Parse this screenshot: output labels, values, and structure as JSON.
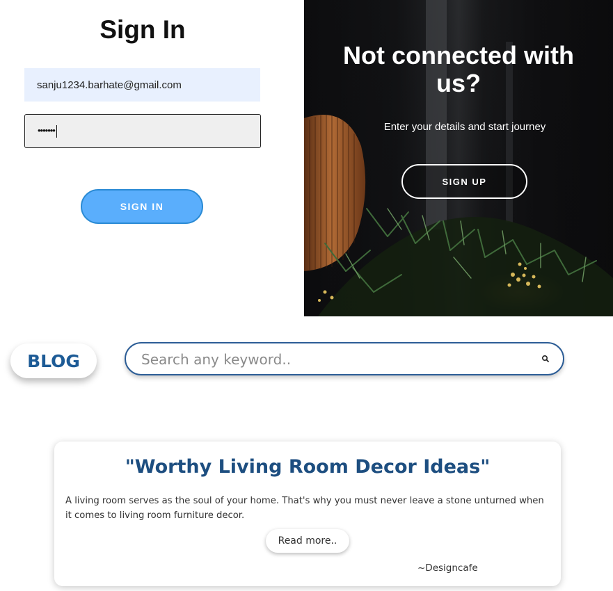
{
  "signin": {
    "title": "Sign In",
    "email_value": "sanju1234.barhate@gmail.com",
    "password_masked": "•••••••",
    "button_label": "SIGN IN"
  },
  "signup": {
    "heading": "Not connected with us?",
    "subtitle": "Enter your details and start journey",
    "button_label": "SIGN UP"
  },
  "blog": {
    "badge_label": "BLOG",
    "search_placeholder": "Search any keyword..",
    "search_icon": "search-icon"
  },
  "article": {
    "title": "\"Worthy Living Room Decor Ideas\"",
    "body": "A living room serves as the soul of your home. That's why you must never leave a stone unturned when it comes to living room furniture decor.",
    "read_more_label": "Read more..",
    "source": "~Designcafe"
  },
  "colors": {
    "signin_button": "#5aaefc",
    "email_field_bg": "#e8f0fe",
    "blog_blue": "#1d5b96",
    "title_blue": "#1d4e80"
  }
}
